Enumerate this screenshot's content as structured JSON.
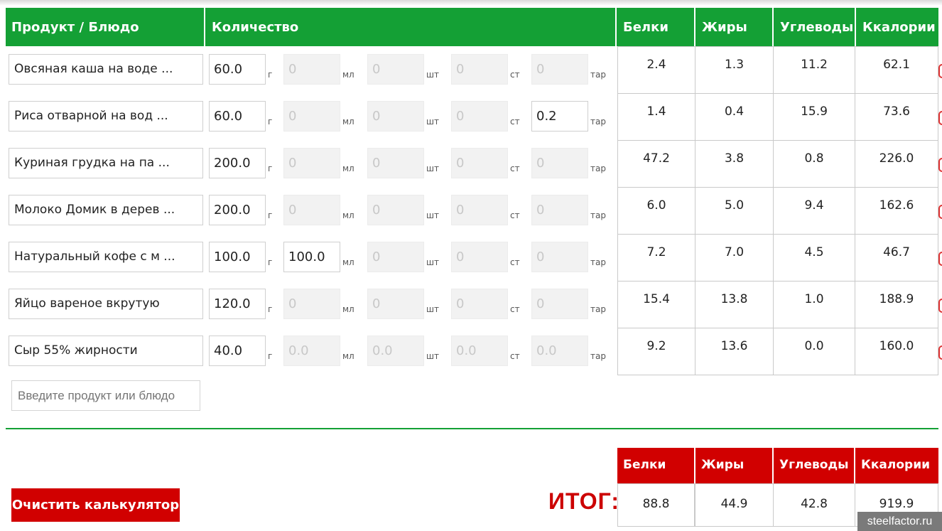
{
  "header": {
    "product_label": "Продукт / Блюдо",
    "quantity_label": "Количество",
    "nutrients": [
      "Белки",
      "Жиры",
      "Углеводы",
      "Ккалории"
    ]
  },
  "units": [
    "г",
    "мл",
    "шт",
    "ст",
    "тар"
  ],
  "rows": [
    {
      "name": "Овсяная каша на воде ...",
      "qty": [
        "60.0",
        "0",
        "0",
        "0",
        "0"
      ],
      "active": [
        true,
        false,
        false,
        false,
        false
      ],
      "nut": [
        "2.4",
        "1.3",
        "11.2",
        "62.1"
      ]
    },
    {
      "name": "Риса отварной на вод ...",
      "qty": [
        "60.0",
        "0",
        "0",
        "0",
        "0.2"
      ],
      "active": [
        true,
        false,
        false,
        false,
        true
      ],
      "nut": [
        "1.4",
        "0.4",
        "15.9",
        "73.6"
      ]
    },
    {
      "name": "Куриная грудка на па ...",
      "qty": [
        "200.0",
        "0",
        "0",
        "0",
        "0"
      ],
      "active": [
        true,
        false,
        false,
        false,
        false
      ],
      "nut": [
        "47.2",
        "3.8",
        "0.8",
        "226.0"
      ]
    },
    {
      "name": "Молоко Домик в дерев ...",
      "qty": [
        "200.0",
        "0",
        "0",
        "0",
        "0"
      ],
      "active": [
        true,
        false,
        false,
        false,
        false
      ],
      "nut": [
        "6.0",
        "5.0",
        "9.4",
        "162.6"
      ]
    },
    {
      "name": "Натуральный кофе с м ...",
      "qty": [
        "100.0",
        "100.0",
        "0",
        "0",
        "0"
      ],
      "active": [
        true,
        true,
        false,
        false,
        false
      ],
      "nut": [
        "7.2",
        "7.0",
        "4.5",
        "46.7"
      ]
    },
    {
      "name": "Яйцо вареное вкрутую",
      "qty": [
        "120.0",
        "0",
        "0",
        "0",
        "0"
      ],
      "active": [
        true,
        false,
        false,
        false,
        false
      ],
      "nut": [
        "15.4",
        "13.8",
        "1.0",
        "188.9"
      ]
    },
    {
      "name": "Сыр 55% жирности",
      "qty": [
        "40.0",
        "0.0",
        "0.0",
        "0.0",
        "0.0"
      ],
      "active": [
        true,
        false,
        false,
        false,
        false
      ],
      "nut": [
        "9.2",
        "13.6",
        "0.0",
        "160.0"
      ]
    }
  ],
  "search": {
    "placeholder": "Введите продукт или блюдо"
  },
  "clear_button": "Очистить калькулятор",
  "total": {
    "label": "ИТОГ:",
    "headers": [
      "Белки",
      "Жиры",
      "Углеводы",
      "Ккалории"
    ],
    "values": [
      "88.8",
      "44.9",
      "42.8",
      "919.9"
    ]
  },
  "watermark": "steelfactor.ru",
  "colors": {
    "header_green": "#14a035",
    "total_red": "#d10000",
    "itog_red": "#cc0000"
  }
}
